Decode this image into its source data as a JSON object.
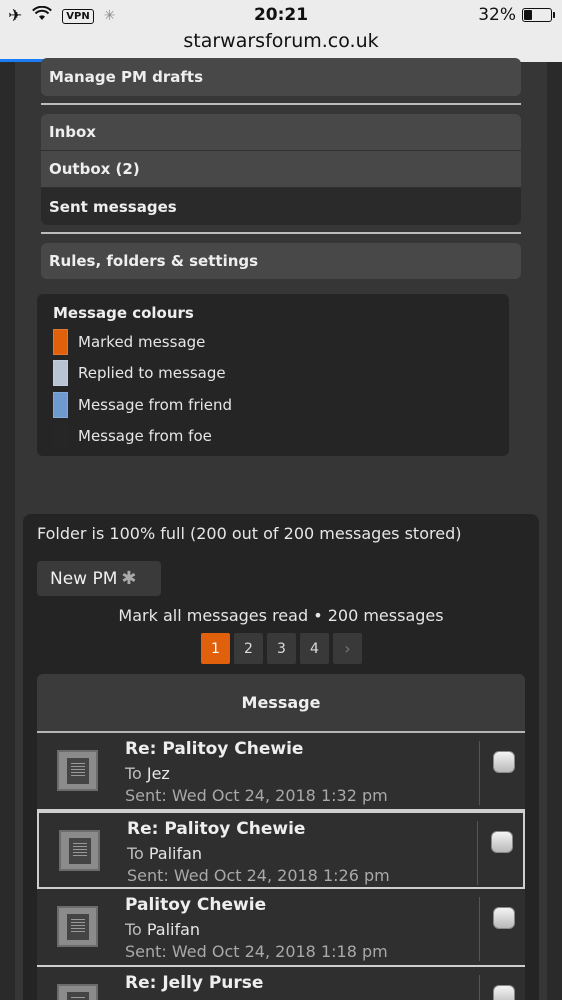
{
  "status_bar": {
    "time": "20:21",
    "vpn": "VPN",
    "battery": "32%",
    "battery_level": 0.32,
    "url": "starwarsforum.co.uk",
    "page_load_progress": 0.4
  },
  "nav": {
    "drafts": "Manage PM drafts",
    "inbox": "Inbox",
    "outbox": "Outbox (2)",
    "sent": "Sent messages",
    "rules": "Rules, folders & settings"
  },
  "legend": {
    "title": "Message colours",
    "items": [
      {
        "label": "Marked message",
        "color": "#e0600c"
      },
      {
        "label": "Replied to message",
        "color": "#b8c4d4"
      },
      {
        "label": "Message from friend",
        "color": "#6e9ad0"
      },
      {
        "label": "Message from foe",
        "color": "#262626"
      }
    ]
  },
  "folder": {
    "status": "Folder is 100% full (200 out of 200 messages stored)",
    "new_pm": "New PM",
    "mark_read": "Mark all messages read • 200 messages",
    "pages": [
      "1",
      "2",
      "3",
      "4"
    ],
    "current_page": "1",
    "next": "›"
  },
  "table": {
    "header": "Message",
    "to_prefix": "To",
    "messages": [
      {
        "subject": "Re: Palitoy Chewie",
        "to": "Jez",
        "sent": "Sent: Wed Oct 24, 2018 1:32 pm"
      },
      {
        "subject": "Re: Palitoy Chewie",
        "to": "Palifan",
        "sent": "Sent: Wed Oct 24, 2018 1:26 pm"
      },
      {
        "subject": "Palitoy Chewie",
        "to": "Palifan",
        "sent": "Sent: Wed Oct 24, 2018 1:18 pm"
      },
      {
        "subject": "Re: Jelly Purse",
        "to": "",
        "sent": ""
      }
    ]
  }
}
